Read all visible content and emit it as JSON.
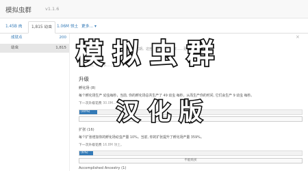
{
  "header": {
    "title": "模拟虫群",
    "version": "v1.1.6"
  },
  "tabs": [
    {
      "label": "1.45B 肉"
    },
    {
      "label": "1,815 幼虫"
    },
    {
      "label": "1.06M 领土"
    },
    {
      "label": "更多..."
    }
  ],
  "sidebar": {
    "items": [
      {
        "label": "成就点",
        "value": "200"
      },
      {
        "label": "幼虫",
        "value": "1,815"
      }
    ]
  },
  "background_text": {
    "line1": "……的幼虫孵化期。这些可能……，一次……更成其他成年单",
    "line2": "……如……",
    "line3": "……虫卵。（+5.5……）"
  },
  "overlay": {
    "line1": "模 拟 虫 群",
    "line2": "汉 化 版"
  },
  "upgrades": {
    "section_title": "升级",
    "hatchery": {
      "title": "孵化场 (8)",
      "desc": "每个孵化场生产 幼虫每秒，当前, 你的孵化场总共生产了 49 幼虫 每秒，从而生产你的时间, 它们会生产 9 幼虫 每秒。",
      "cost_label": "下一次升级花费",
      "cost_value": "30.0M…",
      "progress_text": "(40%)",
      "progress": 0.08,
      "button": "不能购买"
    },
    "expansion": {
      "title": "扩张 (16)",
      "desc": "每个扩张增加你的孵化场幼虫产量 10%。当前, 你的扩张提升了孵化场产量 359%。",
      "cost_label": "下一次升级花费",
      "cost_value": "16.8M 领土。",
      "progress_text": "(6%)",
      "progress": 0.06,
      "button": "不能购买"
    },
    "next": {
      "title": "Accomplished Ancestry (1)"
    }
  },
  "colors": {
    "link": "#337ab7",
    "brand": "#555555"
  }
}
